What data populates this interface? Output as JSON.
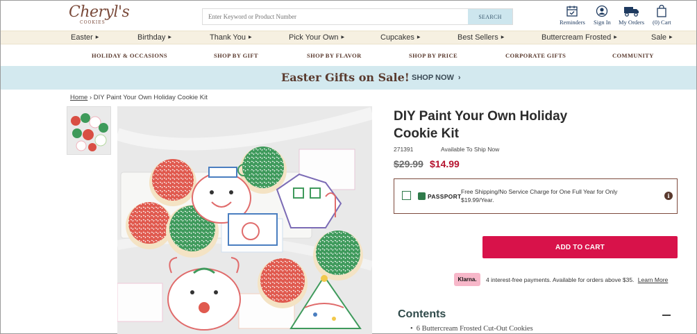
{
  "header": {
    "logo_text": "Cheryl's",
    "logo_sub": "COOKIES",
    "search": {
      "placeholder": "Enter Keyword or Product Number",
      "button_label": "SEARCH"
    },
    "utilities": [
      {
        "label": "Reminders",
        "icon": "calendar-icon"
      },
      {
        "label": "Sign In",
        "icon": "user-icon"
      },
      {
        "label": "My Orders",
        "icon": "truck-icon"
      },
      {
        "label": "(0) Cart",
        "icon": "bag-icon"
      }
    ]
  },
  "categories": [
    "Easter",
    "Birthday",
    "Thank You",
    "Pick Your Own",
    "Cupcakes",
    "Best Sellers",
    "Buttercream Frosted",
    "Sale"
  ],
  "subnav": [
    "HOLIDAY & OCCASIONS",
    "SHOP BY GIFT",
    "SHOP BY FLAVOR",
    "SHOP BY PRICE",
    "CORPORATE GIFTS",
    "COMMUNITY"
  ],
  "banner": {
    "title": "Easter Gifts on Sale!",
    "cta": "SHOP NOW"
  },
  "breadcrumb": {
    "home": "Home",
    "current": "DIY Paint Your Own Holiday Cookie Kit"
  },
  "product": {
    "title": "DIY Paint Your Own Holiday Cookie Kit",
    "sku": "271391",
    "availability": "Available To Ship Now",
    "old_price": "$29.99",
    "price": "$14.99"
  },
  "passport": {
    "logo": "PASSPORT",
    "text": "Free Shipping/No Service Charge for One Full Year for Only $19.99/Year.",
    "info": "i"
  },
  "add_to_cart_label": "ADD TO CART",
  "klarna": {
    "badge": "Klarna.",
    "text": "4 interest-free payments. Available for orders above $35.",
    "link": "Learn More"
  },
  "contents": {
    "title": "Contents",
    "items": [
      "6 Buttercream Frosted Cut-Out Cookies"
    ]
  },
  "colors": {
    "accent_red": "#d8124a",
    "price_red": "#b5122e",
    "banner_bg": "#d3e9ef",
    "brand_brown": "#5a3a2e"
  }
}
